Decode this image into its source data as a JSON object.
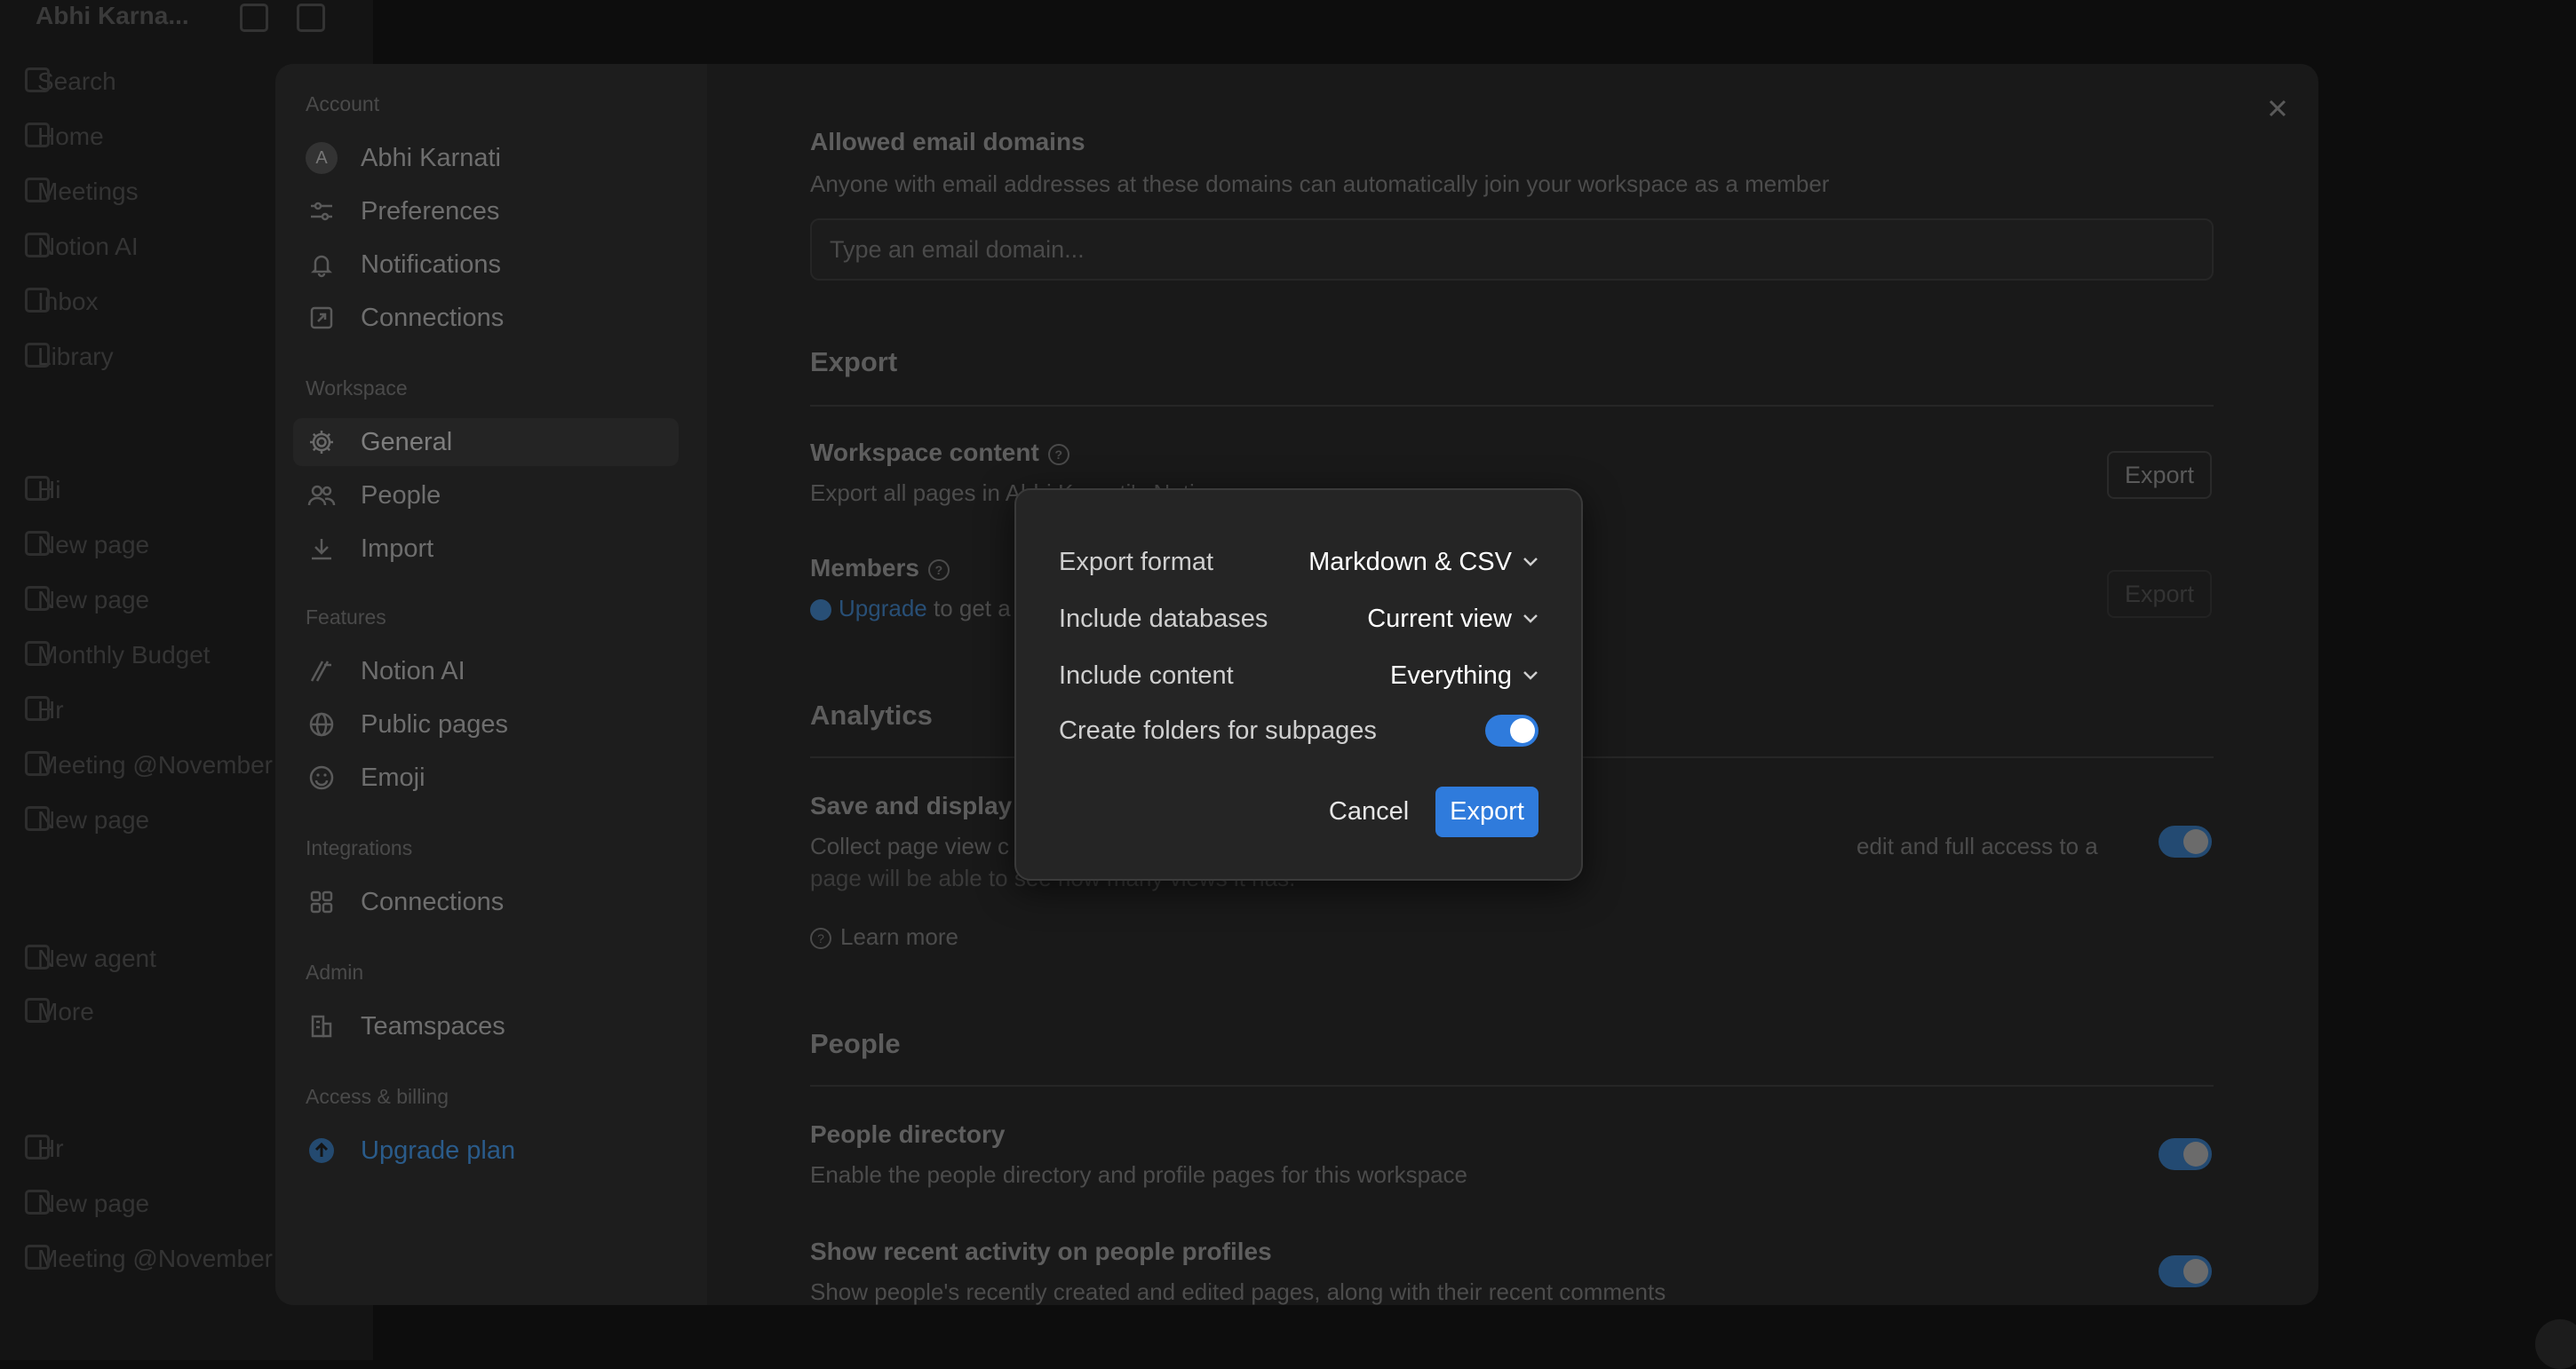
{
  "app": {
    "workspace_name": "Abhi Karna...",
    "nav": [
      {
        "label": "Search",
        "icon": "search-icon"
      },
      {
        "label": "Home",
        "icon": "home-icon"
      },
      {
        "label": "Meetings",
        "icon": "meetings-icon"
      },
      {
        "label": "Notion AI",
        "icon": "notion-ai-icon"
      },
      {
        "label": "Inbox",
        "icon": "inbox-icon"
      },
      {
        "label": "Library",
        "icon": "library-icon"
      }
    ],
    "pages": [
      "Hi",
      "New page",
      "New page",
      "Monthly Budget",
      "Hr",
      "Meeting @November",
      "New page"
    ],
    "agents": [
      "New agent",
      "More"
    ],
    "private": [
      "Hr",
      "New page",
      "Meeting @November"
    ]
  },
  "settings": {
    "sections": {
      "account": "Account",
      "workspace": "Workspace",
      "features": "Features",
      "integrations": "Integrations",
      "admin": "Admin",
      "billing": "Access & billing"
    },
    "account_items": [
      "Abhi Karnati",
      "Preferences",
      "Notifications",
      "Connections"
    ],
    "avatar_letter": "A",
    "workspace_items": [
      "General",
      "People",
      "Import"
    ],
    "features_items": [
      "Notion AI",
      "Public pages",
      "Emoji"
    ],
    "integrations_items": [
      "Connections"
    ],
    "admin_items": [
      "Teamspaces"
    ],
    "billing_items": [
      "Upgrade plan"
    ],
    "main": {
      "allowed_domains_title": "Allowed email domains",
      "allowed_domains_desc": "Anyone with email addresses at these domains can automatically join your workspace as a member",
      "domain_placeholder": "Type an email domain...",
      "export_heading": "Export",
      "workspace_content_title": "Workspace content",
      "workspace_content_desc": "Export all pages in Abhi Karnati's Notion",
      "members_title": "Members",
      "members_upgrade_link": "Upgrade",
      "members_desc": "to get a",
      "export_button": "Export",
      "analytics_heading": "Analytics",
      "save_display_title": "Save and display",
      "save_display_desc_1": "Collect page view c",
      "save_display_desc_1b": "edit and full access to a",
      "save_display_desc_2": "page will be able to see how many views it has.",
      "learn_more": "Learn more",
      "people_heading": "People",
      "people_directory_title": "People directory",
      "people_directory_desc": "Enable the people directory and profile pages for this workspace",
      "recent_activity_title": "Show recent activity on people profiles",
      "recent_activity_desc": "Show people's recently created and edited pages, along with their recent comments"
    }
  },
  "export_dialog": {
    "format_label": "Export format",
    "format_value": "Markdown & CSV",
    "databases_label": "Include databases",
    "databases_value": "Current view",
    "content_label": "Include content",
    "content_value": "Everything",
    "folders_label": "Create folders for subpages",
    "folders_enabled": true,
    "cancel_label": "Cancel",
    "export_label": "Export",
    "accent_color": "#2f7bdc"
  }
}
